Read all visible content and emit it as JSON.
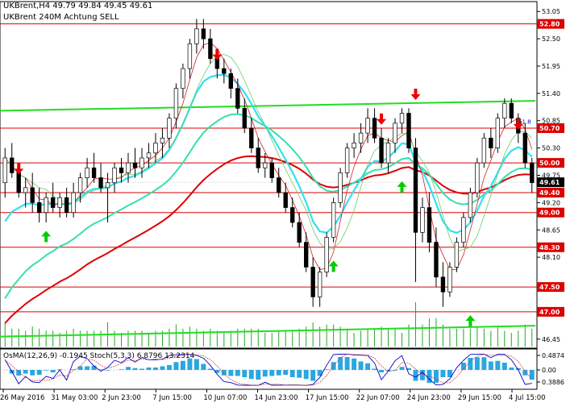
{
  "header": {
    "symbol_line": "UKBrent,H4  49.79 49.84 49.45 49.61",
    "indicator_line": "UKBrent 240M    Achtung SELL"
  },
  "indicator": {
    "label": "OsMA(12,26,9) -0.1945  Stoch(5,3,3) 6.8796 13.2314",
    "axis_labels": [
      "0.4874",
      "0.00",
      "0.3886"
    ]
  },
  "colors": {
    "candles": "#000000",
    "ema_long": "#dd0000",
    "ema_mid": "#33e0b0",
    "ema_cyan": "#33e0f0",
    "channel": "#22dd22",
    "level_line": "#dd0000",
    "arrow_down": "#ee0000",
    "arrow_up": "#00cc00",
    "osma": "#2aa7e0",
    "stoch": "#0000cc"
  },
  "chart_data": {
    "type": "candlestick",
    "price_axis": {
      "ticks": [
        "53.05",
        "52.50",
        "51.95",
        "51.40",
        "50.85",
        "50.30",
        "49.75",
        "49.20",
        "48.65",
        "48.10",
        "46.45"
      ],
      "range": [
        46.3,
        53.2
      ]
    },
    "time_axis": {
      "labels": [
        "26 May 2016",
        "31 May 03:00",
        "2 Jun 23:00",
        "7 Jun 15:00",
        "10 Jun 07:00",
        "14 Jun 23:00",
        "17 Jun 15:00",
        "22 Jun 07:00",
        "24 Jun 23:00",
        "29 Jun 15:00",
        "4 Jul 15:00"
      ]
    },
    "levels": [
      {
        "value": 52.8,
        "label": "52.80"
      },
      {
        "value": 50.7,
        "label": "50.70"
      },
      {
        "value": 50.0,
        "label": "50.00"
      },
      {
        "value": 49.4,
        "label": "49.40"
      },
      {
        "value": 49.0,
        "label": "49.00"
      },
      {
        "value": 48.3,
        "label": "48.30"
      },
      {
        "value": 47.5,
        "label": "47.50"
      },
      {
        "value": 47.0,
        "label": "47.00"
      }
    ],
    "current_price": {
      "value": 49.61,
      "label": "49.61"
    },
    "fib_label": "61.8",
    "channel": {
      "start": 51.05,
      "end": 51.25
    },
    "lower_channel": {
      "start": 46.5,
      "end": 46.72
    },
    "candles": [
      [
        49.6,
        50.3,
        49.3,
        50.1
      ],
      [
        50.1,
        50.4,
        49.7,
        49.8
      ],
      [
        49.8,
        50.0,
        49.3,
        49.4
      ],
      [
        49.4,
        49.7,
        49.1,
        49.5
      ],
      [
        49.5,
        49.8,
        49.0,
        49.2
      ],
      [
        49.2,
        49.5,
        48.8,
        49.0
      ],
      [
        49.0,
        49.4,
        48.8,
        49.3
      ],
      [
        49.3,
        49.6,
        49.0,
        49.1
      ],
      [
        49.1,
        49.4,
        48.9,
        49.3
      ],
      [
        49.3,
        49.5,
        48.9,
        49.0
      ],
      [
        49.0,
        49.6,
        48.9,
        49.4
      ],
      [
        49.4,
        49.8,
        49.2,
        49.7
      ],
      [
        49.7,
        50.1,
        49.5,
        49.9
      ],
      [
        49.9,
        50.2,
        49.6,
        49.7
      ],
      [
        49.7,
        50.0,
        49.4,
        49.5
      ],
      [
        49.5,
        49.8,
        48.8,
        49.6
      ],
      [
        49.6,
        50.0,
        49.4,
        49.9
      ],
      [
        49.9,
        50.1,
        49.6,
        49.8
      ],
      [
        49.8,
        50.2,
        49.6,
        50.0
      ],
      [
        50.0,
        50.3,
        49.7,
        49.9
      ],
      [
        49.9,
        50.3,
        49.7,
        50.1
      ],
      [
        50.1,
        50.4,
        49.9,
        50.2
      ],
      [
        50.2,
        50.6,
        50.0,
        50.4
      ],
      [
        50.4,
        50.7,
        50.1,
        50.5
      ],
      [
        50.5,
        51.0,
        50.3,
        50.9
      ],
      [
        50.9,
        51.6,
        50.7,
        51.5
      ],
      [
        51.5,
        52.0,
        51.3,
        51.9
      ],
      [
        51.9,
        52.5,
        51.7,
        52.4
      ],
      [
        52.4,
        52.9,
        52.2,
        52.7
      ],
      [
        52.7,
        52.9,
        52.3,
        52.5
      ],
      [
        52.5,
        52.7,
        52.0,
        52.1
      ],
      [
        52.1,
        52.3,
        51.7,
        51.9
      ],
      [
        51.9,
        52.1,
        51.6,
        51.8
      ],
      [
        51.8,
        51.9,
        51.3,
        51.5
      ],
      [
        51.5,
        51.7,
        51.0,
        51.1
      ],
      [
        51.1,
        51.3,
        50.6,
        50.7
      ],
      [
        50.7,
        50.9,
        50.2,
        50.3
      ],
      [
        50.3,
        50.5,
        49.8,
        49.9
      ],
      [
        49.9,
        50.2,
        49.7,
        50.0
      ],
      [
        50.0,
        50.1,
        49.6,
        49.7
      ],
      [
        49.7,
        49.9,
        49.3,
        49.4
      ],
      [
        49.4,
        49.6,
        49.0,
        49.1
      ],
      [
        49.1,
        49.3,
        48.7,
        48.8
      ],
      [
        48.8,
        49.0,
        48.3,
        48.4
      ],
      [
        48.4,
        48.6,
        47.8,
        47.9
      ],
      [
        47.9,
        48.1,
        47.1,
        47.3
      ],
      [
        47.3,
        47.9,
        47.1,
        47.8
      ],
      [
        47.8,
        48.6,
        47.7,
        48.5
      ],
      [
        48.5,
        49.3,
        48.4,
        49.2
      ],
      [
        49.2,
        49.9,
        49.1,
        49.8
      ],
      [
        49.8,
        50.4,
        49.7,
        50.3
      ],
      [
        50.3,
        50.6,
        50.1,
        50.4
      ],
      [
        50.4,
        50.8,
        50.2,
        50.6
      ],
      [
        50.6,
        51.1,
        50.4,
        50.9
      ],
      [
        50.9,
        51.1,
        50.4,
        50.5
      ],
      [
        50.5,
        50.7,
        49.9,
        50.0
      ],
      [
        50.0,
        50.5,
        49.8,
        50.4
      ],
      [
        50.4,
        50.9,
        50.2,
        50.8
      ],
      [
        50.8,
        51.1,
        50.6,
        51.0
      ],
      [
        51.0,
        51.1,
        50.2,
        50.3
      ],
      [
        50.3,
        50.5,
        47.6,
        48.6
      ],
      [
        48.6,
        49.3,
        48.4,
        49.1
      ],
      [
        49.1,
        49.4,
        48.2,
        48.4
      ],
      [
        48.4,
        48.7,
        47.5,
        47.7
      ],
      [
        47.7,
        48.0,
        47.1,
        47.4
      ],
      [
        47.4,
        48.0,
        47.3,
        47.9
      ],
      [
        47.9,
        48.5,
        47.8,
        48.4
      ],
      [
        48.4,
        49.0,
        48.3,
        48.9
      ],
      [
        48.9,
        49.5,
        48.8,
        49.4
      ],
      [
        49.4,
        50.1,
        49.3,
        50.0
      ],
      [
        50.0,
        50.6,
        49.9,
        50.5
      ],
      [
        50.5,
        50.7,
        50.1,
        50.3
      ],
      [
        50.3,
        51.0,
        50.2,
        50.9
      ],
      [
        50.9,
        51.3,
        50.7,
        51.2
      ],
      [
        51.2,
        51.3,
        50.8,
        50.9
      ],
      [
        50.9,
        51.0,
        50.4,
        50.6
      ],
      [
        50.6,
        50.8,
        49.9,
        50.0
      ],
      [
        50.0,
        50.1,
        49.4,
        49.6
      ]
    ],
    "arrows": [
      {
        "dir": "down",
        "i": 2,
        "price": 49.85
      },
      {
        "dir": "up",
        "i": 6,
        "price": 48.55
      },
      {
        "dir": "down",
        "i": 31,
        "price": 52.15
      },
      {
        "dir": "down",
        "i": 55,
        "price": 50.85
      },
      {
        "dir": "up",
        "i": 58,
        "price": 49.55
      },
      {
        "dir": "down",
        "i": 60,
        "price": 51.35
      },
      {
        "dir": "up",
        "i": 48,
        "price": 47.95
      },
      {
        "dir": "up",
        "i": 68,
        "price": 46.85
      },
      {
        "dir": "down",
        "i": 75,
        "price": 50.75
      }
    ]
  }
}
